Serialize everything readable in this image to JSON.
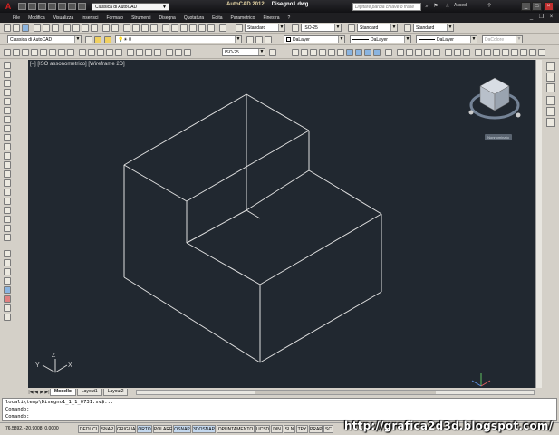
{
  "app": {
    "name": "AutoCAD 2012",
    "document": "Disegno1.dwg",
    "workspace": "Classica di AutoCAD"
  },
  "search": {
    "placeholder": "Digitare parola chiave o frase"
  },
  "account": {
    "login_label": "Accedi"
  },
  "menu": [
    "File",
    "Modifica",
    "Visualizza",
    "Inserisci",
    "Formato",
    "Strumenti",
    "Disegna",
    "Quotatura",
    "Edita",
    "Parametrico",
    "Finestra",
    "?"
  ],
  "toolbar": {
    "text_style": "Standard",
    "dim_style": "ISO-25",
    "table_style": "Standard",
    "multileader_style": "Standard",
    "workspace_combo": "Classica di AutoCAD",
    "layer": "0",
    "color": "DaLayer",
    "linetype": "DaLayer",
    "lineweight": "DaLayer",
    "plotstyle": "DaColore",
    "dim_style_2": "ISO-25"
  },
  "viewport": {
    "label": "[–] [ISO assonometrico] [Wireframe 2D]",
    "viewcube_label": "Nonnominato",
    "ucs_x": "X",
    "ucs_y": "Y",
    "ucs_z": "Z"
  },
  "tabs": [
    "Modello",
    "Layout1",
    "Layout2"
  ],
  "command_lines": [
    "locali\\temp\\Disegno1_1_1_0731.sv$...",
    "Comando:",
    "Comando:"
  ],
  "status": {
    "coordinates": "76.5892, -20.9008, 0.0000",
    "buttons": [
      {
        "label": "DEDUCI",
        "on": false
      },
      {
        "label": "SNAP",
        "on": false
      },
      {
        "label": "GRIGLIA",
        "on": false
      },
      {
        "label": "ORTO",
        "on": true
      },
      {
        "label": "POLARE",
        "on": false
      },
      {
        "label": "OSNAP",
        "on": true
      },
      {
        "label": "3DOSNAP",
        "on": true
      },
      {
        "label": "OPUNTAMENTO",
        "on": false
      },
      {
        "label": "UCSD",
        "on": false
      },
      {
        "label": "DIN",
        "on": false
      },
      {
        "label": "SLN",
        "on": false
      },
      {
        "label": "TPY",
        "on": false
      },
      {
        "label": "PRAP",
        "on": false
      },
      {
        "label": "SC",
        "on": false
      }
    ]
  },
  "watermark": "http://grafica2d3d.blogspot.com/",
  "colors": {
    "viewport_bg": "#212830",
    "model_lines": "#e0e0e0",
    "titlebar": "#1f1f22",
    "active_button": "#c4d8ee"
  }
}
